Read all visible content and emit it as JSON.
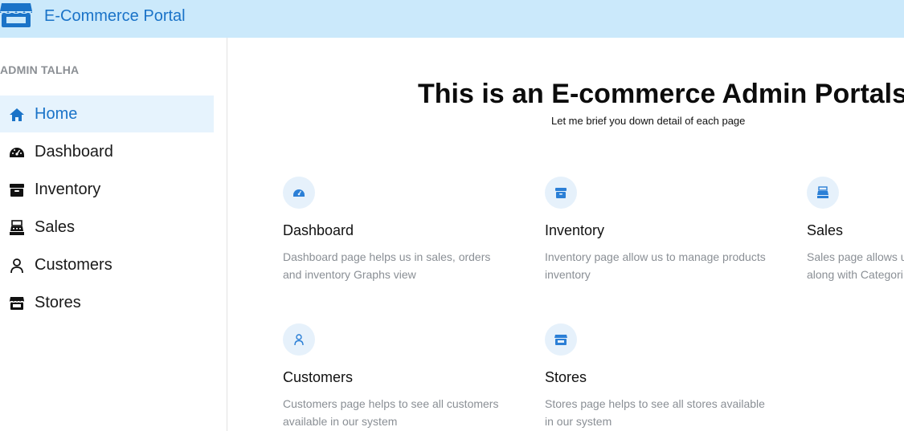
{
  "app": {
    "title": "E-Commerce Portal",
    "brand_icon": "store-icon"
  },
  "sidebar": {
    "user_label": "ADMIN TALHA",
    "items": [
      {
        "label": "Home",
        "icon": "home-icon",
        "active": true
      },
      {
        "label": "Dashboard",
        "icon": "dashboard-icon",
        "active": false
      },
      {
        "label": "Inventory",
        "icon": "inventory-icon",
        "active": false
      },
      {
        "label": "Sales",
        "icon": "sales-icon",
        "active": false
      },
      {
        "label": "Customers",
        "icon": "user-icon",
        "active": false
      },
      {
        "label": "Stores",
        "icon": "store-icon",
        "active": false
      }
    ]
  },
  "main": {
    "heading": "This is an E-commerce Admin Portals",
    "subheading": "Let me brief you down detail of each page",
    "cards": [
      {
        "title": "Dashboard",
        "icon": "dashboard-icon",
        "desc_line1": "Dashboard page helps us in sales, orders",
        "desc_line2": "and inventory Graphs view"
      },
      {
        "title": "Inventory",
        "icon": "inventory-icon",
        "desc_line1": "Inventory page allow us to manage products",
        "desc_line2": "inventory"
      },
      {
        "title": "Sales",
        "icon": "sales-icon",
        "desc_line1": "Sales page allows us",
        "desc_line2": "along with Categori"
      },
      {
        "title": "Customers",
        "icon": "user-icon",
        "desc_line1": "Customers page helps to see all customers",
        "desc_line2": "available in our system"
      },
      {
        "title": "Stores",
        "icon": "store-icon",
        "desc_line1": "Stores page helps to see all stores available",
        "desc_line2": "in our system"
      }
    ]
  },
  "colors": {
    "topbar_bg": "#cbe9fb",
    "accent": "#1a73c8",
    "active_bg": "#e6f3fd",
    "muted_text": "#8a8f95",
    "icon_circle_bg": "#e6f1fb"
  }
}
